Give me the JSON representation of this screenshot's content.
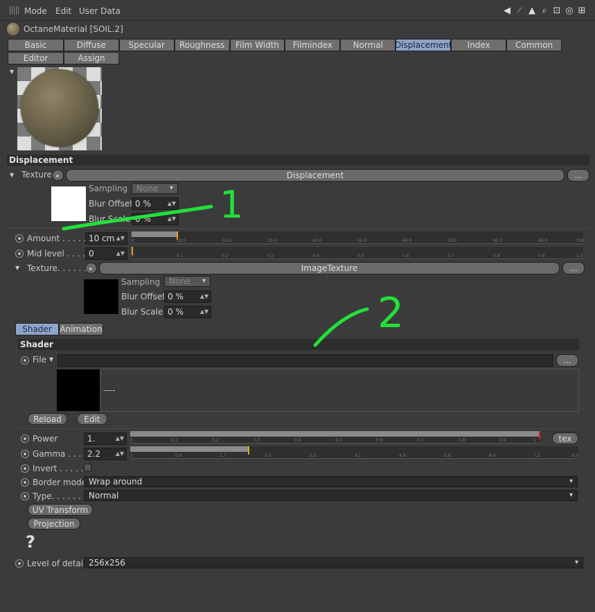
{
  "menu": {
    "mode": "Mode",
    "edit": "Edit",
    "user_data": "User Data"
  },
  "material": {
    "title": "OctaneMaterial [SOIL.2]"
  },
  "tabs": [
    "Basic",
    "Diffuse",
    "Specular",
    "Roughness",
    "Film Width",
    "Filmindex",
    "Normal",
    "Displacement",
    "Index",
    "Common"
  ],
  "tabs_row2": [
    "Editor",
    "Assign"
  ],
  "active_tab": "Displacement",
  "displacement": {
    "section_title": "Displacement",
    "texture_label": "Texture",
    "texture_button": "Displacement",
    "more_button": "...",
    "sampling_label": "Sampling",
    "sampling_value": "None",
    "blur_offset_label": "Blur Offset",
    "blur_offset_value": "0 %",
    "blur_scale_label": "Blur Scale",
    "blur_scale_value": "0 %",
    "amount_label": "Amount . . . . .",
    "amount_value": "10 cm",
    "amount_fraction": 0.1,
    "amount_ticks": [
      "0",
      "10.0",
      "20.0",
      "30.0",
      "40.0",
      "50.0",
      "60.0",
      "70.0",
      "80.0",
      "90.0",
      "100"
    ],
    "mid_label": "Mid level . . . . .",
    "mid_value": "0",
    "mid_fraction": 0,
    "mid_ticks": [
      "0",
      "0.1",
      "0.2",
      "0.3",
      "0.4",
      "0.5",
      "0.6",
      "0.7",
      "0.8",
      "0.9",
      "1.0"
    ],
    "texture2_label": "Texture. . . . . . .",
    "texture2_button": "ImageTexture",
    "sampling2_value": "None",
    "blur_offset2_value": "0 %",
    "blur_scale2_value": "0 %"
  },
  "shader": {
    "subtab_shader": "Shader",
    "subtab_animation": "Animation",
    "section_title": "Shader",
    "file_label": "File",
    "file_value": "",
    "preview_text": "----",
    "reload_button": "Reload",
    "edit_button": "Edit",
    "power_label": "Power",
    "power_value": "1.",
    "power_fraction": 1.0,
    "power_ticks": [
      "0",
      "0.1",
      "0.2",
      "0.3",
      "0.4",
      "0.5",
      "0.6",
      "0.7",
      "0.8",
      "0.9",
      "1"
    ],
    "tex_button": "tex",
    "gamma_label": "Gamma . . . . .",
    "gamma_value": "2.2",
    "gamma_fraction": 0.262,
    "gamma_ticks": [
      "1",
      "0.9",
      "1.7",
      "2.5",
      "3.3",
      "4.1",
      "4.9",
      "5.6",
      "6.4",
      "7.2",
      "8.0"
    ],
    "invert_label": "Invert . . . . . .",
    "border_label": "Border mode",
    "border_value": "Wrap around",
    "type_label": "Type. . . . . . .",
    "type_value": "Normal",
    "uv_button": "UV Transform",
    "projection_button": "Projection",
    "help_glyph": "?",
    "lod_label": "Level of details",
    "lod_value": "256x256"
  },
  "annotations": {
    "one": "1",
    "two": "2",
    "color": "#22e03a"
  }
}
